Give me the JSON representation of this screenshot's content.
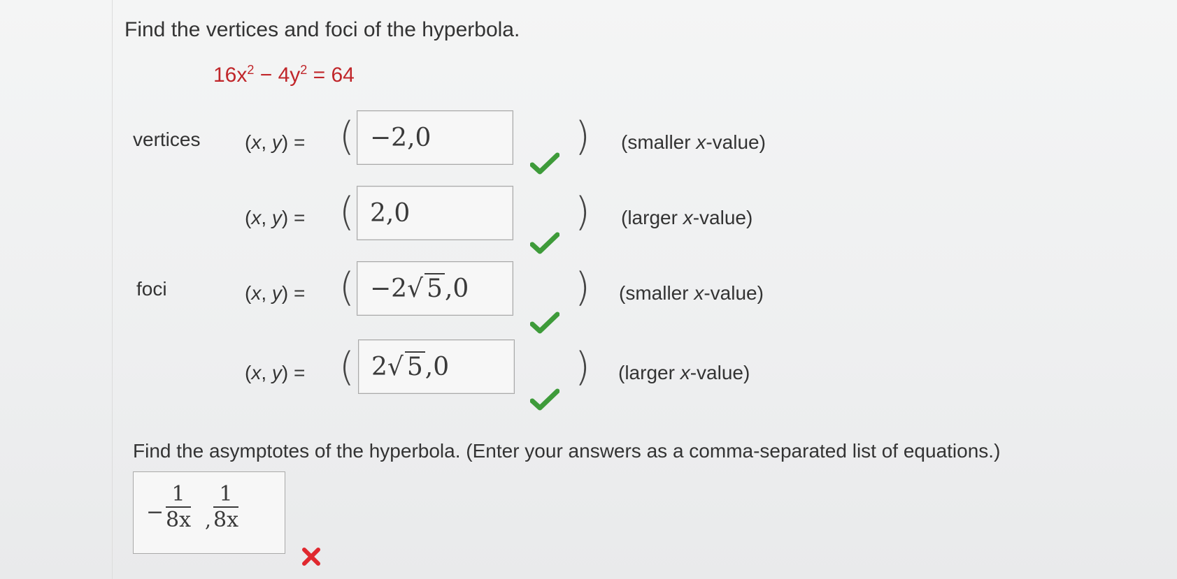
{
  "question": {
    "title": "Find the vertices and foci of the hyperbola.",
    "equation": {
      "term1": "16x",
      "exp1": "2",
      "op": " − 4y",
      "exp2": "2",
      "rhs": " = 64"
    }
  },
  "labels": {
    "vertices": "vertices",
    "foci": "foci",
    "xy_prefix": "(",
    "x": "x",
    "sep": ", ",
    "y": "y",
    "xy_suffix": ") =",
    "open_paren": "(",
    "close_paren": ")"
  },
  "vertices": [
    {
      "value": "−2,0",
      "hint_prefix": "(smaller ",
      "hint_var": "x",
      "hint_suffix": "-value)",
      "status": "correct"
    },
    {
      "value": "2,0",
      "hint_prefix": "(larger ",
      "hint_var": "x",
      "hint_suffix": "-value)",
      "status": "correct"
    }
  ],
  "foci": [
    {
      "coef": "−2",
      "radicand": "5",
      "tail": ",0",
      "hint_prefix": "(smaller ",
      "hint_var": "x",
      "hint_suffix": "-value)",
      "status": "correct"
    },
    {
      "coef": "2",
      "radicand": "5",
      "tail": ",0",
      "hint_prefix": "(larger ",
      "hint_var": "x",
      "hint_suffix": "-value)",
      "status": "correct"
    }
  ],
  "asymptotes": {
    "prompt": "Find the asymptotes of the hyperbola. (Enter your answers as a comma-separated list of equations.)",
    "answer": {
      "minus": "−",
      "frac1_num": "1",
      "frac1_den": "8x",
      "comma": ",",
      "frac2_num": "1",
      "frac2_den": "8x"
    },
    "status": "incorrect"
  },
  "colors": {
    "correct": "#3e9b3a",
    "incorrect": "#e0282f",
    "equation": "#c0262a"
  },
  "icons": {
    "correct": "checkmark-icon",
    "incorrect": "x-mark-icon"
  }
}
